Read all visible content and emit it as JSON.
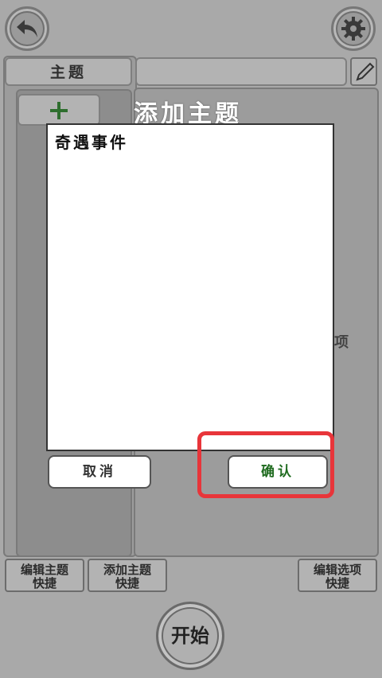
{
  "header": {
    "back_icon": "back-arrow-icon",
    "settings_icon": "gear-icon"
  },
  "topic_panel": {
    "tab_label": "主题",
    "add_icon": "plus-icon"
  },
  "right_panel": {
    "edit_icon": "pencil-icon",
    "partial_text": "项"
  },
  "dialog": {
    "title": "添加主题",
    "text_value": "奇遇事件",
    "cancel_label": "取消",
    "confirm_label": "确认"
  },
  "bottom_bar": {
    "edit_topic_line1": "编辑主题",
    "edit_topic_line2": "快捷",
    "add_topic_line1": "添加主题",
    "add_topic_line2": "快捷",
    "edit_option_line1": "编辑选项",
    "edit_option_line2": "快捷",
    "start_label": "开始"
  },
  "colors": {
    "highlight": "#e8353a",
    "confirm_text": "#1f6b1f",
    "plus_green": "#2e6e2e"
  }
}
